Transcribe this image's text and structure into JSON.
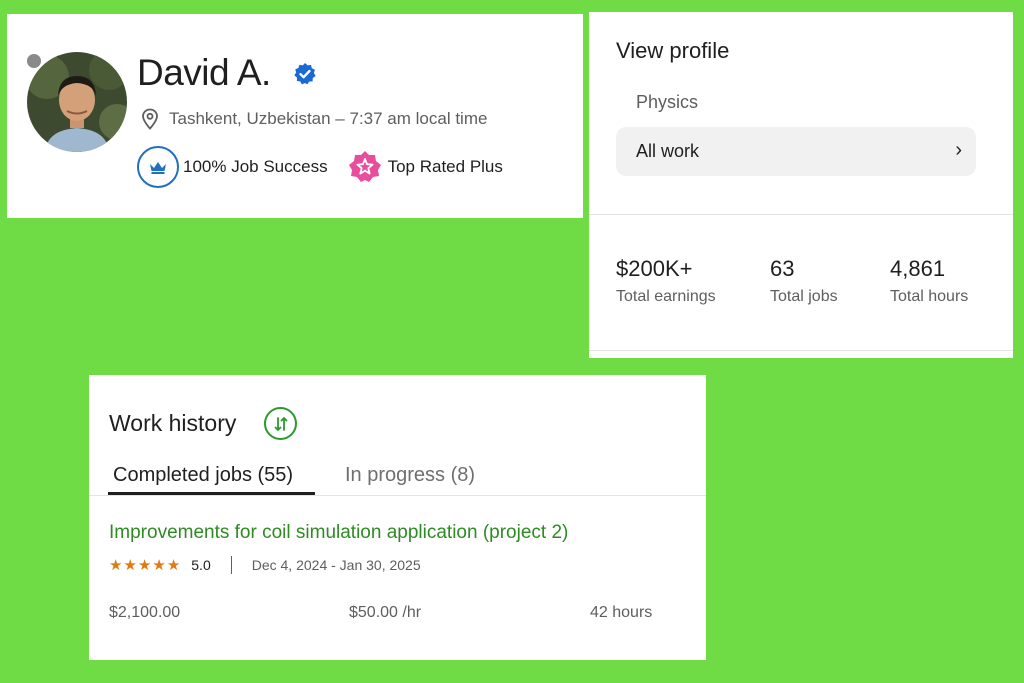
{
  "profile": {
    "name": "David A.",
    "location": "Tashkent, Uzbekistan – 7:37 am local time",
    "job_success": "100% Job Success",
    "badge": "Top Rated Plus",
    "verified_color": "#1a6ad6"
  },
  "view_profile": {
    "title": "View profile",
    "specialized": "Physics",
    "all_work": "All work",
    "stats": [
      {
        "value": "$200K+",
        "label": "Total earnings"
      },
      {
        "value": "63",
        "label": "Total jobs"
      },
      {
        "value": "4,861",
        "label": "Total hours"
      }
    ]
  },
  "work_history": {
    "title": "Work history",
    "tabs": [
      {
        "label": "Completed jobs (55)",
        "active": true
      },
      {
        "label": "In progress (8)",
        "active": false
      }
    ],
    "job": {
      "title": "Improvements for coil simulation application (project 2)",
      "rating": "5.0",
      "stars": 5,
      "dates": "Dec 4, 2024 - Jan 30, 2025",
      "amount": "$2,100.00",
      "rate": "$50.00 /hr",
      "hours": "42 hours"
    }
  },
  "colors": {
    "background": "#6fdc46",
    "accent_green": "#2e8b24",
    "star": "#e07b12",
    "badge_pink": "#e84d9e",
    "jss_blue": "#1f70c1"
  }
}
